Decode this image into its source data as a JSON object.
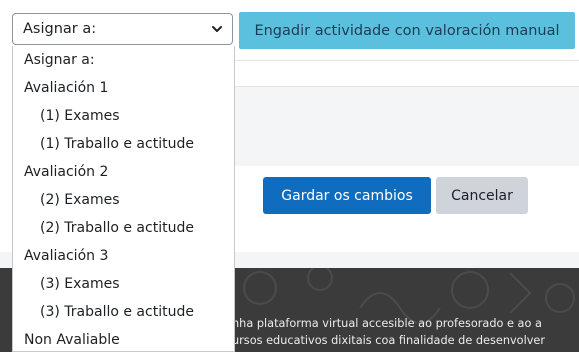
{
  "select": {
    "value": "Asignar a:"
  },
  "dropdown": {
    "options": [
      {
        "label": "Asignar a:",
        "level": 0
      },
      {
        "label": "Avaliación 1",
        "level": 0
      },
      {
        "label": "(1) Exames",
        "level": 1
      },
      {
        "label": "(1) Traballo e actitude",
        "level": 1
      },
      {
        "label": "Avaliación 2",
        "level": 0
      },
      {
        "label": "(2) Exames",
        "level": 1
      },
      {
        "label": "(2) Traballo e actitude",
        "level": 1
      },
      {
        "label": "Avaliación 3",
        "level": 0
      },
      {
        "label": "(3) Exames",
        "level": 1
      },
      {
        "label": "(3) Traballo e actitude",
        "level": 1
      },
      {
        "label": "Non Avaliable",
        "level": 0
      }
    ]
  },
  "buttons": {
    "add_manual": "Engadir actividade con valoración manual",
    "save": "Gardar os cambios",
    "cancel": "Cancelar"
  },
  "footer": {
    "line1": "nha plataforma virtual accesible ao profesorado e ao a",
    "line2": "ursos educativos dixitais coa finalidade de desenvolver"
  },
  "colors": {
    "add_button": "#5bc0de",
    "save_button": "#0f6cbf",
    "cancel_button": "#ced4da",
    "footer_bg": "#3b3b3b"
  }
}
